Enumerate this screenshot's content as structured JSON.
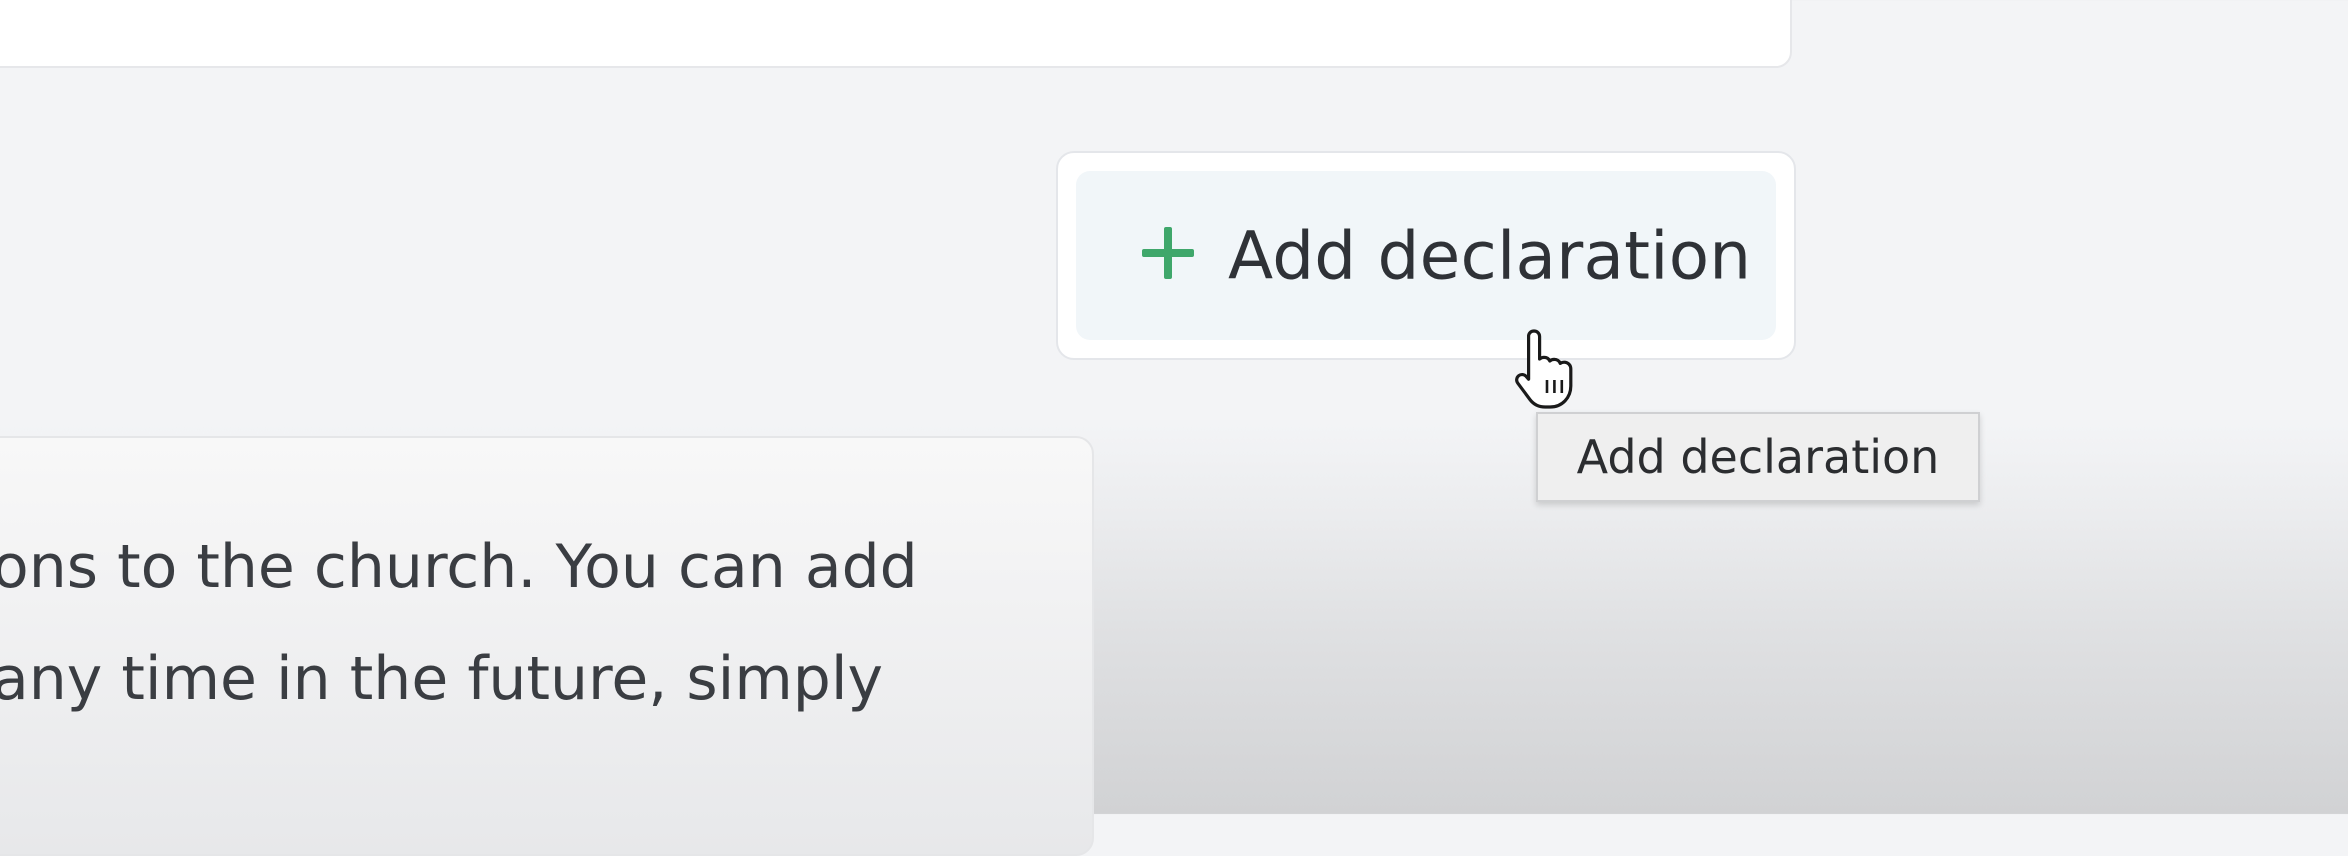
{
  "add_declaration": {
    "button_label": "Add declaration",
    "icon": "plus-icon",
    "icon_color": "#3fa76b"
  },
  "tooltip": {
    "text": "Add declaration"
  },
  "description": {
    "lines": [
      "ons to the church. You can add",
      "any time in the future, simply"
    ]
  }
}
